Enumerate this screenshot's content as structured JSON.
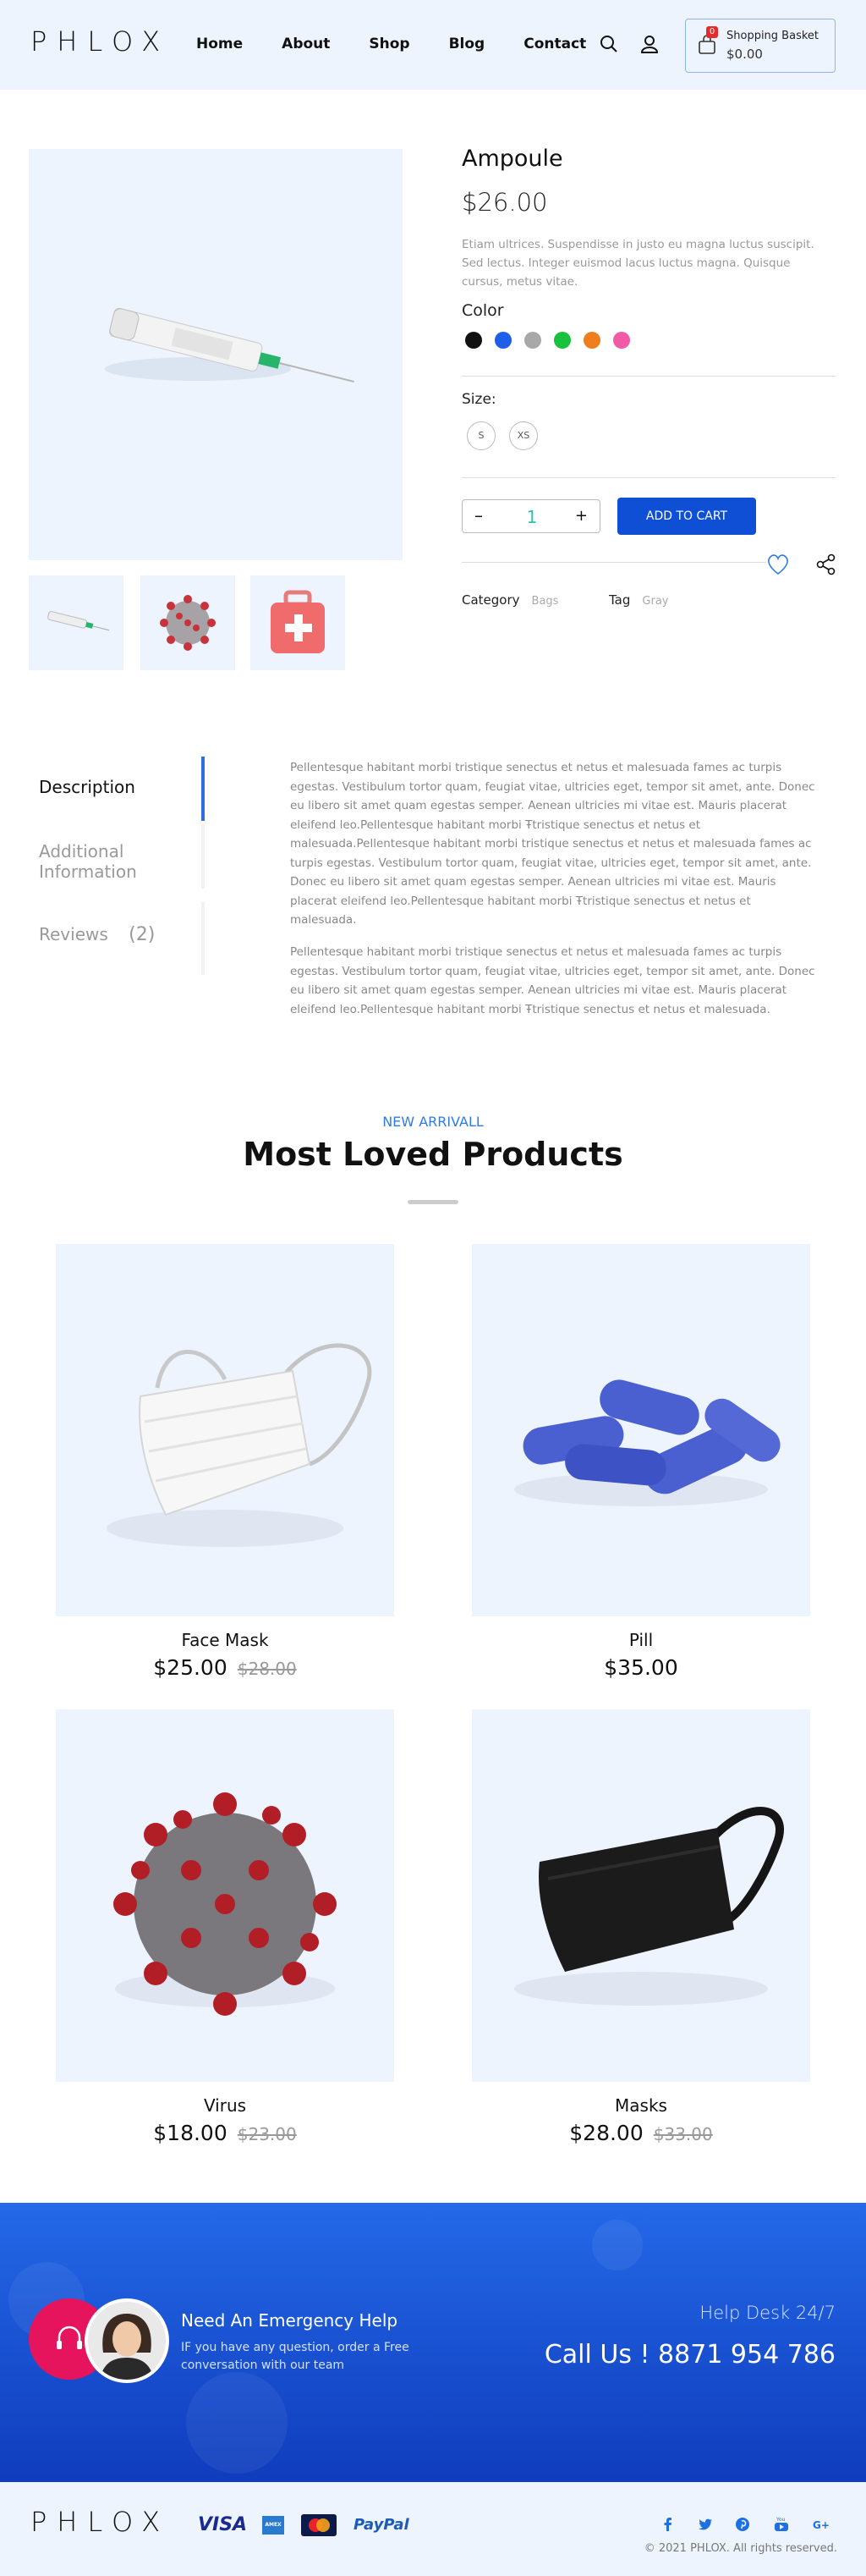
{
  "brand": {
    "logo": "PHLOX"
  },
  "nav": {
    "items": [
      "Home",
      "About",
      "Shop",
      "Blog",
      "Contact"
    ]
  },
  "basket": {
    "label": "Shopping Basket",
    "price": "$0.00",
    "count": "0"
  },
  "product": {
    "title": "Ampoule",
    "price": "$26.00",
    "description": "Etiam ultrices. Suspendisse in justo eu magna luctus suscipit. Sed lectus. Integer euismod lacus luctus magna. Quisque cursus, metus vitae.",
    "color_label": "Color",
    "colors": [
      "#111111",
      "#1f5ee8",
      "#a8a8a8",
      "#19c23c",
      "#f07d1e",
      "#f05aa6"
    ],
    "size_label": "Size:",
    "sizes": [
      "S",
      "XS"
    ],
    "quantity": "1",
    "add_to_cart": "ADD TO CART",
    "category_label": "Category",
    "category_value": "Bags",
    "tag_label": "Tag",
    "tag_value": "Gray"
  },
  "tabs": {
    "description": "Description",
    "additional_l1": "Additional",
    "additional_l2": "Information",
    "reviews": "Reviews",
    "reviews_count": "(2)"
  },
  "desc_text": {
    "p1": "Pellentesque habitant morbi tristique senectus et netus et malesuada fames ac turpis egestas. Vestibulum tortor quam, feugiat vitae, ultricies eget, tempor sit amet, ante. Donec eu libero sit amet quam egestas semper. Aenean ultricies mi vitae est. Mauris placerat eleifend leo.Pellentesque habitant morbi Ŧtristique senectus et netus et malesuada.Pellentesque habitant morbi tristique senectus et netus et malesuada fames ac turpis egestas. Vestibulum tortor quam, feugiat vitae, ultricies eget, tempor sit amet, ante. Donec eu libero sit amet quam egestas semper. Aenean ultricies mi vitae est. Mauris placerat eleifend leo.Pellentesque habitant morbi Ŧtristique senectus et netus et malesuada.",
    "p2": "Pellentesque habitant morbi tristique senectus et netus et malesuada fames ac turpis egestas. Vestibulum tortor quam, feugiat vitae, ultricies eget, tempor sit amet, ante. Donec eu libero sit amet quam egestas semper. Aenean ultricies mi vitae est. Mauris placerat eleifend leo.Pellentesque habitant morbi Ŧtristique senectus et netus et malesuada."
  },
  "section": {
    "kicker": "NEW ARRIVALL",
    "title": "Most Loved Products"
  },
  "products": [
    {
      "name": "Face Mask",
      "price": "$25.00",
      "old_price": "$28.00"
    },
    {
      "name": "Pill",
      "price": "$35.00",
      "old_price": ""
    },
    {
      "name": "Virus",
      "price": "$18.00",
      "old_price": "$23.00"
    },
    {
      "name": "Masks",
      "price": "$28.00",
      "old_price": "$33.00"
    }
  ],
  "emergency": {
    "title": "Need An Emergency Help",
    "subtitle": "IF you have any question, order a Free conversation with our team",
    "help_desk": "Help Desk 24/7",
    "call": "Call Us ! 8871 954 786"
  },
  "footer": {
    "logo": "PHLOX",
    "payments": [
      "VISA",
      "AMEX",
      "MasterCard",
      "PayPal"
    ],
    "social_icons": [
      "facebook-icon",
      "twitter-icon",
      "pinterest-icon",
      "youtube-icon",
      "google-plus-icon"
    ],
    "copyright": "© 2021 PHLOX. All rights reserved."
  }
}
